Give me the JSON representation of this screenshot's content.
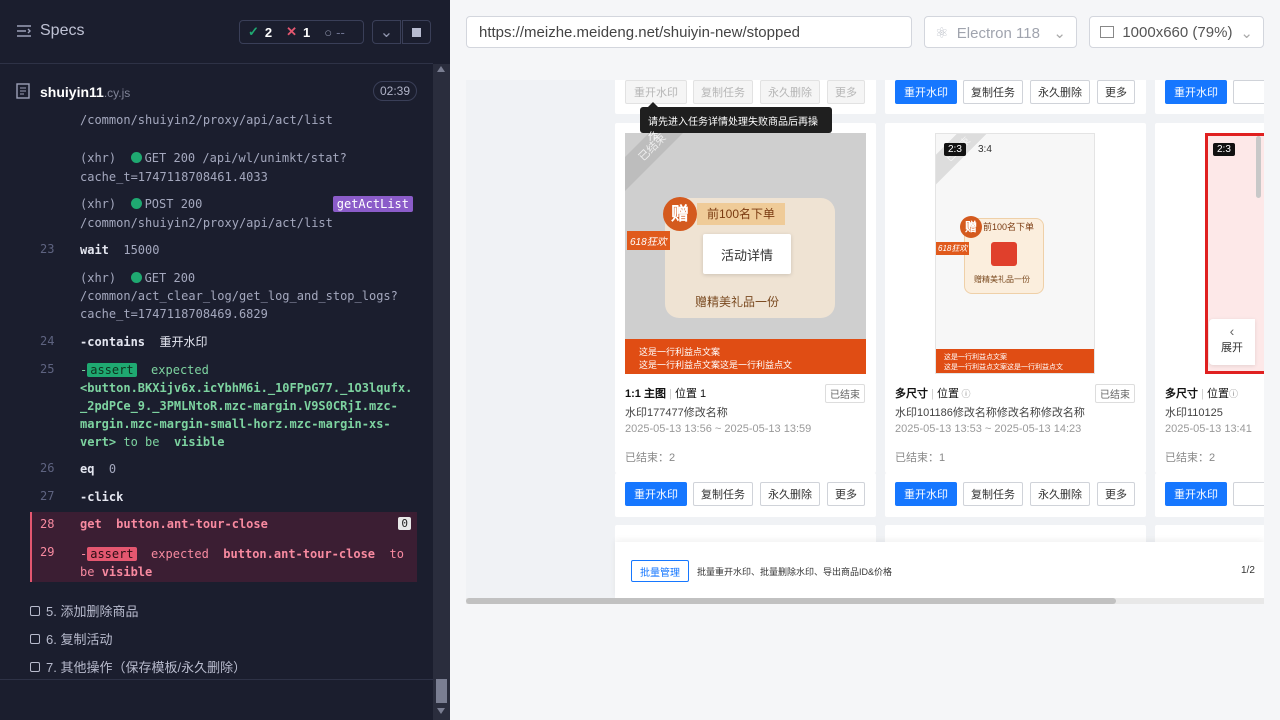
{
  "specs": {
    "title": "Specs",
    "passed": "2",
    "failed": "1",
    "pending": "--",
    "file_name": "shuiyin11",
    "file_ext": ".cy.js",
    "timer": "02:39"
  },
  "log": {
    "r0_path": "/common/shuiyin2/proxy/api/act/list",
    "r1_type": "(xhr)",
    "r1_method": "GET 200 /api/wl/unimkt/stat?",
    "r1_query": "cache_t=1747118708461.4033",
    "r2_type": "(xhr)",
    "r2_method": "POST 200",
    "r2_path": "/common/shuiyin2/proxy/api/act/list",
    "r2_alias": "getActList",
    "r3_num": "23",
    "r3_cmd": "wait",
    "r3_arg": "15000",
    "r4_type": "(xhr)",
    "r4_method": "GET 200",
    "r4_path": "/common/act_clear_log/get_log_and_stop_logs?",
    "r4_query": "cache_t=1747118708469.6829",
    "r5_num": "24",
    "r5_cmd": "-contains",
    "r5_arg": "重开水印",
    "r6_num": "25",
    "r6_dash": "-",
    "r6_assert": "assert",
    "r6_expected": "expected",
    "r6_l1": "<button.BKXijv6x.icYbhM6i._10FPpG77._1O3lqufx.",
    "r6_l2": "_2pdPCe_9._3PMLNtoR.mzc-margin.V9S0CRjI.mzc-",
    "r6_l3": "margin.mzc-margin-small-horz.mzc-margin-xs-",
    "r6_l4": "vert>",
    "r6_tobe": "to be",
    "r6_vis": "visible",
    "r7_num": "26",
    "r7_cmd": "eq",
    "r7_arg": "0",
    "r8_num": "27",
    "r8_cmd": "-click",
    "r9_num": "28",
    "r9_cmd": "get",
    "r9_arg": "button.ant-tour-close",
    "r9_count": "0",
    "r10_num": "29",
    "r10_dash": "-",
    "r10_assert": "assert",
    "r10_expected": "expected",
    "r10_arg": "button.ant-tour-close",
    "r10_tobe": "to be",
    "r10_vis": "visible"
  },
  "suites": [
    "5. 添加删除商品",
    "6. 复制活动",
    "7. 其他操作（保存模板/永久删除）"
  ],
  "browser": {
    "url": "https://meizhe.meideng.net/shuiyin-new/stopped",
    "engine": "Electron 118",
    "viewport": "1000x660",
    "zoom": "(79%)"
  },
  "app": {
    "top_buttons": [
      "重开水印",
      "复制任务",
      "永久删除",
      "更多"
    ],
    "tooltip": "请先进入任务详情处理失败商品后再操作",
    "cards": [
      {
        "ratio_tag": "",
        "title": "1:1 主图",
        "pos": "位置 1",
        "status": "已结束",
        "name": "水印177477修改名称",
        "date": "2025-05-13 13:56 ~ 2025-05-13 13:59",
        "ended": "已结束：2"
      },
      {
        "ratio_tag": "2:3",
        "ratio2": "3:4",
        "title": "多尺寸",
        "pos": "位置",
        "status": "已结束",
        "name": "水印101186修改名称修改名称修改名称",
        "date": "2025-05-13 13:53 ~ 2025-05-13 14:23",
        "ended": "已结束：1"
      },
      {
        "ratio_tag": "2:3",
        "title": "多尺寸",
        "pos": "位置",
        "status": "",
        "name": "水印110125",
        "date": "2025-05-13 13:41",
        "ended": "已结束：2"
      }
    ],
    "overlay_label": "活动详情",
    "img_gift": "赠",
    "img_top": "前100名下单",
    "img_bottom": "赠精美礼品一份",
    "img_banner1": "这是一行利益点文案",
    "img_banner2": "这是一行利益点文案这是一行利益点文",
    "ribbon": "已结束",
    "badge618": "618狂欢",
    "expand": "展开",
    "bulk_button": "批量管理",
    "bulk_desc": "批量重开水印、批量删除水印、导出商品ID&价格",
    "page": "1/2"
  }
}
